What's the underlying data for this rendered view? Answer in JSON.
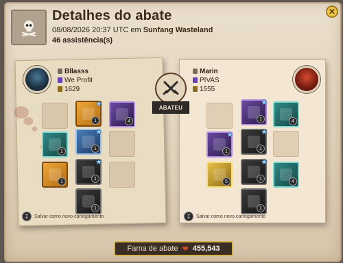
{
  "header": {
    "title": "Detalhes do abate",
    "date_time": "08/08/2026 20:37 UTC em ",
    "location": "Sunfang Wasteland",
    "assists": "46 assistência(s)"
  },
  "killer": {
    "name": "Bllasss",
    "guild": "We Profit",
    "ip": "1629",
    "save_label": "Salvar como novo carregamento"
  },
  "victim": {
    "name": "Marin",
    "guild": "PIVAS",
    "ip": "1555",
    "save_label": "Salvar como novo carregamento"
  },
  "center": {
    "label": "ABATEU"
  },
  "fame": {
    "label": "Fama de abate",
    "value": "455,543"
  },
  "colors": {
    "accent_gold": "#d7b34e",
    "parchment": "#eadfcd",
    "dark_ribbon": "#2f2a27",
    "fame_heart": "#d94b2a"
  },
  "icons": {
    "header": "skull-crossbones-icon",
    "close": "close-icon",
    "center": "crossed-swords-icon",
    "save": "save-loadout-icon",
    "fame": "fame-icon"
  }
}
